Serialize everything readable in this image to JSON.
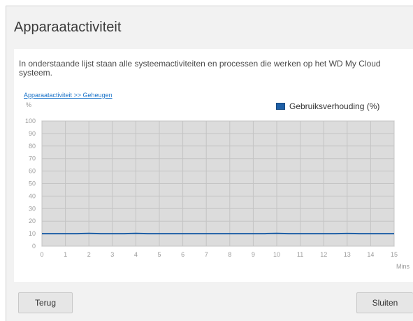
{
  "dialog": {
    "title": "Apparaatactiviteit",
    "description": "In onderstaande lijst staan alle systeemactiviteiten en processen die werken op het WD My Cloud systeem.",
    "breadcrumb_link": "Apparaatactiviteit >> Geheugen",
    "back_button": "Terug",
    "close_button": "Sluiten"
  },
  "chart_data": {
    "type": "line",
    "ylabel": "%",
    "xlabel": "Mins",
    "ylim": [
      0,
      100
    ],
    "xlim": [
      0,
      15
    ],
    "yticks": [
      0,
      10,
      20,
      30,
      40,
      50,
      60,
      70,
      80,
      90,
      100
    ],
    "xticks": [
      0,
      1,
      2,
      3,
      4,
      5,
      6,
      7,
      8,
      9,
      10,
      11,
      12,
      13,
      14,
      15
    ],
    "grid": true,
    "legend_position": "top-right",
    "series": [
      {
        "name": "Gebruiksverhouding (%)",
        "color": "#1e5fa6",
        "x": [
          0,
          0.5,
          1,
          1.5,
          2,
          2.5,
          3,
          3.5,
          4,
          4.5,
          5,
          5.5,
          6,
          6.5,
          7,
          7.5,
          8,
          8.5,
          9,
          9.5,
          10,
          10.5,
          11,
          11.5,
          12,
          12.5,
          13,
          13.5,
          14,
          14.5,
          15
        ],
        "y": [
          10,
          10,
          10,
          10,
          10.2,
          10,
          10,
          10,
          10.2,
          10,
          10,
          10,
          10,
          10,
          10,
          10,
          10,
          10,
          10,
          10,
          10.2,
          10,
          10,
          10,
          10,
          10,
          10.1,
          10,
          10,
          10,
          10
        ]
      }
    ]
  }
}
